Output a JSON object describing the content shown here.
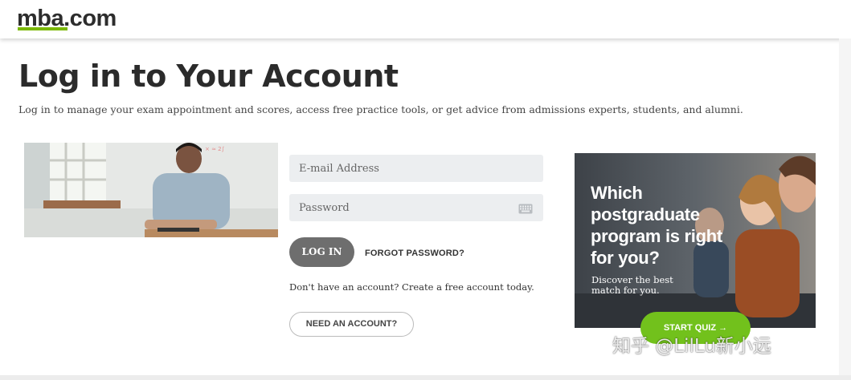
{
  "header": {
    "logo_text": "mba.com"
  },
  "main": {
    "title": "Log in to Your Account",
    "subtitle": "Log in to manage your exam appointment and scores, access free practice tools, or get advice from admissions experts, students, and alumni."
  },
  "form": {
    "email_placeholder": "E-mail Address",
    "password_placeholder": "Password",
    "login_label": "LOG IN",
    "forgot_label": "FORGOT PASSWORD?",
    "no_account_text": "Don't have an account? Create a free account today.",
    "need_account_label": "NEED AN ACCOUNT?"
  },
  "ad": {
    "title": "Which postgraduate program is right for you?",
    "subtitle": "Discover the best match for you.",
    "cta_label": "START QUIZ →"
  },
  "watermark": "知乎 @LilLu新小远",
  "colors": {
    "brand_green": "#7ab800",
    "quiz_green": "#72c11c",
    "login_gray": "#6e6e6e"
  }
}
